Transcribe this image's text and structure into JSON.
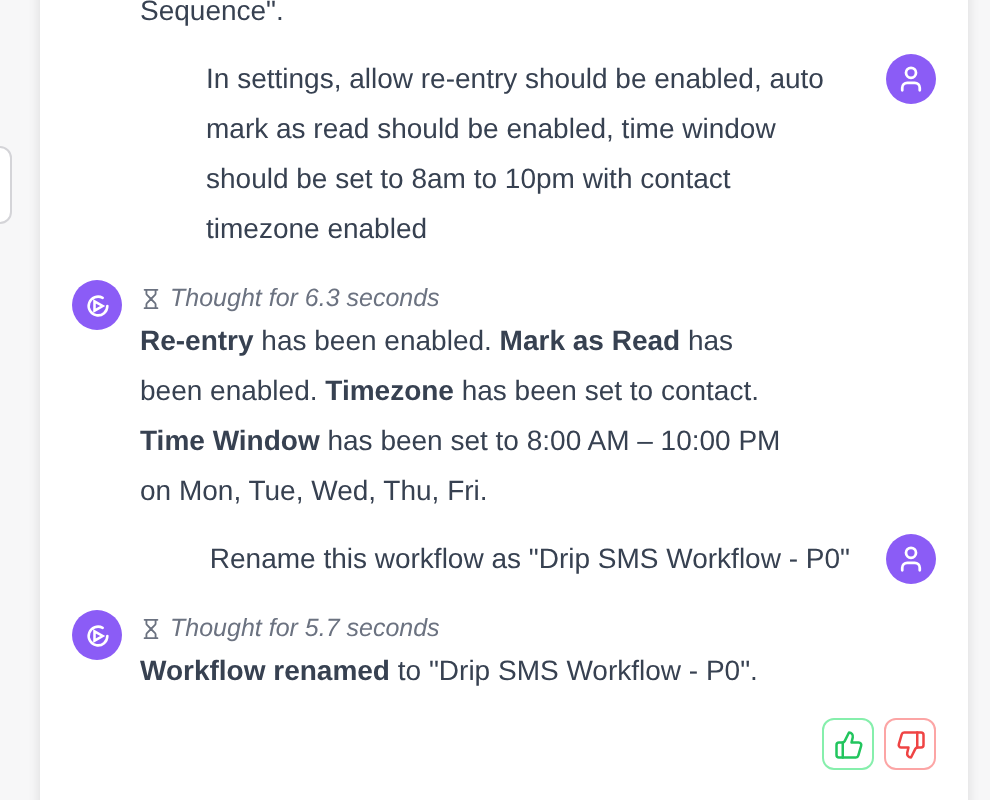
{
  "messages": [
    {
      "kind": "fragment",
      "text": "Sequence\"."
    },
    {
      "kind": "user",
      "text": "In settings, allow re-entry should be enabled, auto mark as read should be enabled, time window should be set to 8am to 10pm with contact timezone enabled"
    },
    {
      "kind": "bot",
      "thought": "Thought for 6.3 seconds",
      "text": "**Re-entry** has been enabled. **Mark as Read** has been enabled. **Timezone** has been set to contact. **Time Window** has been set to 8:00 AM – 10:00 PM on Mon, Tue, Wed, Thu, Fri."
    },
    {
      "kind": "user",
      "text": "Rename this workflow as \"Drip SMS Workflow - P0\""
    },
    {
      "kind": "bot",
      "thought": "Thought for 5.7 seconds",
      "text": "**Workflow renamed** to \"Drip SMS Workflow - P0\"."
    }
  ]
}
